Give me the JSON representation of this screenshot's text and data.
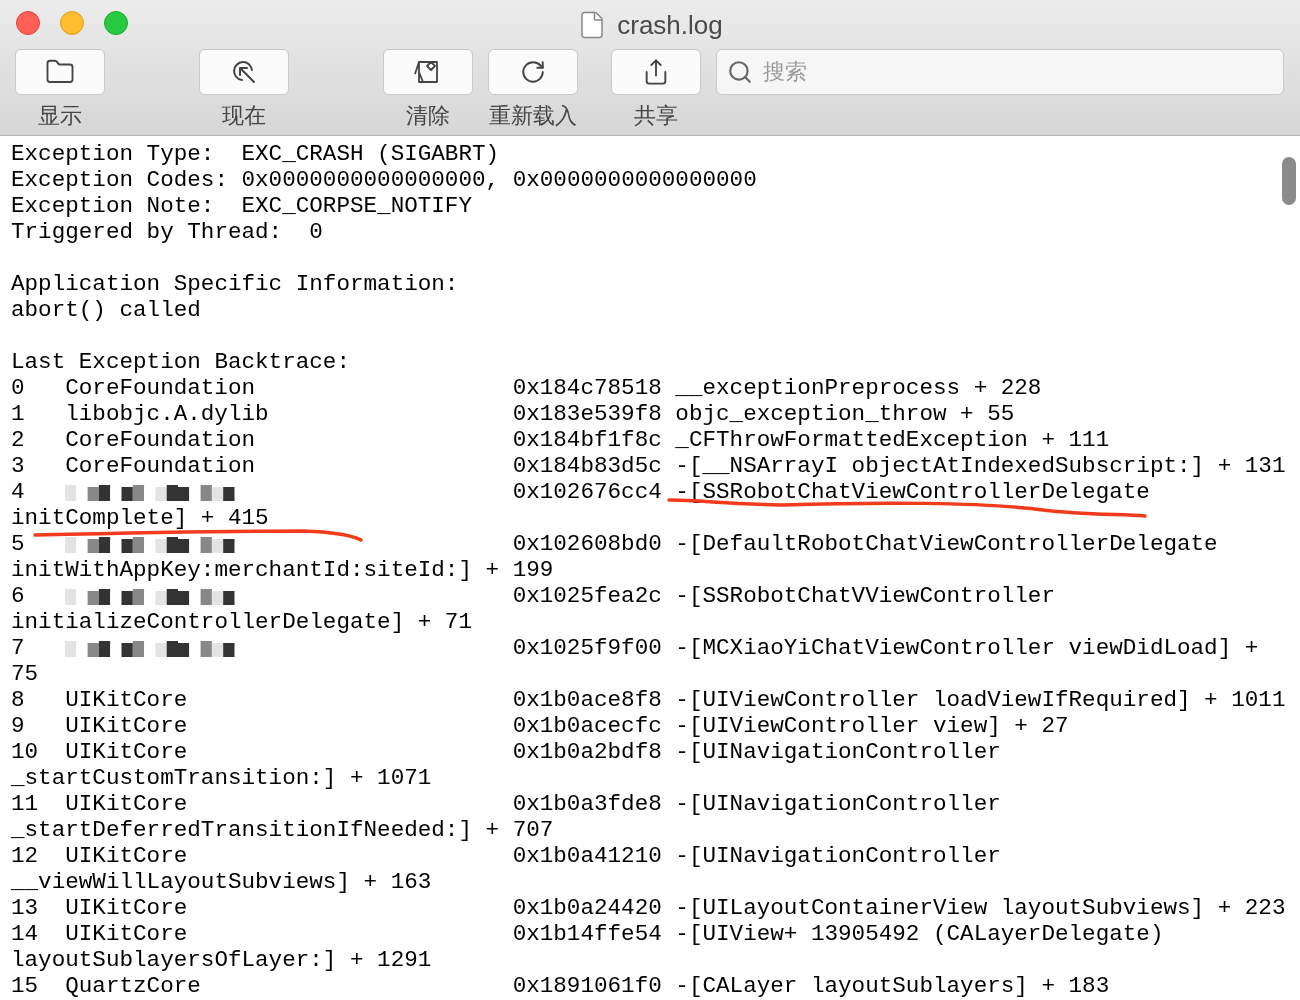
{
  "window": {
    "title": "crash.log"
  },
  "toolbar": {
    "buttons": [
      {
        "kind": "folder",
        "label": "显示"
      },
      {
        "kind": "locate",
        "label": "现在"
      },
      {
        "kind": "clear",
        "label": "清除"
      },
      {
        "kind": "reload",
        "label": "重新载入"
      },
      {
        "kind": "share",
        "label": "共享"
      }
    ],
    "search": {
      "placeholder": "搜索"
    }
  },
  "log": {
    "header": [
      [
        "Exception Type:  EXC_CRASH (SIGABRT)",
        "Exception Codes: 0x0000000000000000, 0x0000000000000000",
        "Exception Note:  EXC_CORPSE_NOTIFY",
        "Triggered by Thread:  0"
      ],
      [
        "Application Specific Information:",
        "abort() called"
      ],
      [
        "Last Exception Backtrace:"
      ]
    ],
    "frames": [
      {
        "index": "0",
        "module": "CoreFoundation",
        "redacted": false,
        "address": "0x184c78518",
        "symbol": "__exceptionPreprocess + 228"
      },
      {
        "index": "1",
        "module": "libobjc.A.dylib",
        "redacted": false,
        "address": "0x183e539f8",
        "symbol": "objc_exception_throw + 55"
      },
      {
        "index": "2",
        "module": "CoreFoundation",
        "redacted": false,
        "address": "0x184bf1f8c",
        "symbol": "_CFThrowFormattedException + 111"
      },
      {
        "index": "3",
        "module": "CoreFoundation",
        "redacted": false,
        "address": "0x184b83d5c",
        "symbol": "-[__NSArrayI objectAtIndexedSubscript:] + 131"
      },
      {
        "index": "4",
        "redacted": true,
        "address": "0x102676cc4",
        "symbol": "-[SSRobotChatViewControllerDelegate",
        "continued": "initComplete] + 415",
        "underlined": true
      },
      {
        "index": "5",
        "redacted": true,
        "address": "0x102608bd0",
        "symbol": "-[DefaultRobotChatViewControllerDelegate",
        "continued": "initWithAppKey:merchantId:siteId:] + 199"
      },
      {
        "index": "6",
        "redacted": true,
        "address": "0x1025fea2c",
        "symbol": "-[SSRobotChatVViewController",
        "continued": "initializeControllerDelegate] + 71"
      },
      {
        "index": "7",
        "redacted": true,
        "address": "0x1025f9f00",
        "symbol": "-[MCXiaoYiChatViewController viewDidLoad] +",
        "continued": "75"
      },
      {
        "index": "8",
        "module": "UIKitCore",
        "redacted": false,
        "address": "0x1b0ace8f8",
        "symbol": "-[UIViewController loadViewIfRequired] + 1011"
      },
      {
        "index": "9",
        "module": "UIKitCore",
        "redacted": false,
        "address": "0x1b0acecfc",
        "symbol": "-[UIViewController view] + 27"
      },
      {
        "index": "10",
        "module": "UIKitCore",
        "redacted": false,
        "address": "0x1b0a2bdf8",
        "symbol": "-[UINavigationController",
        "continued": "_startCustomTransition:] + 1071"
      },
      {
        "index": "11",
        "module": "UIKitCore",
        "redacted": false,
        "address": "0x1b0a3fde8",
        "symbol": "-[UINavigationController",
        "continued": "_startDeferredTransitionIfNeeded:] + 707"
      },
      {
        "index": "12",
        "module": "UIKitCore",
        "redacted": false,
        "address": "0x1b0a41210",
        "symbol": "-[UINavigationController",
        "continued": "__viewWillLayoutSubviews] + 163"
      },
      {
        "index": "13",
        "module": "UIKitCore",
        "redacted": false,
        "address": "0x1b0a24420",
        "symbol": "-[UILayoutContainerView layoutSubviews] + 223"
      },
      {
        "index": "14",
        "module": "UIKitCore",
        "redacted": false,
        "address": "0x1b14ffe54",
        "symbol": "-[UIView+ 13905492 (CALayerDelegate)",
        "continued": "layoutSublayersOfLayer:] + 1291"
      },
      {
        "index": "15",
        "module": "QuartzCore",
        "redacted": false,
        "address": "0x1891061f0",
        "symbol": "-[CALayer layoutSublayers] + 183"
      }
    ]
  }
}
